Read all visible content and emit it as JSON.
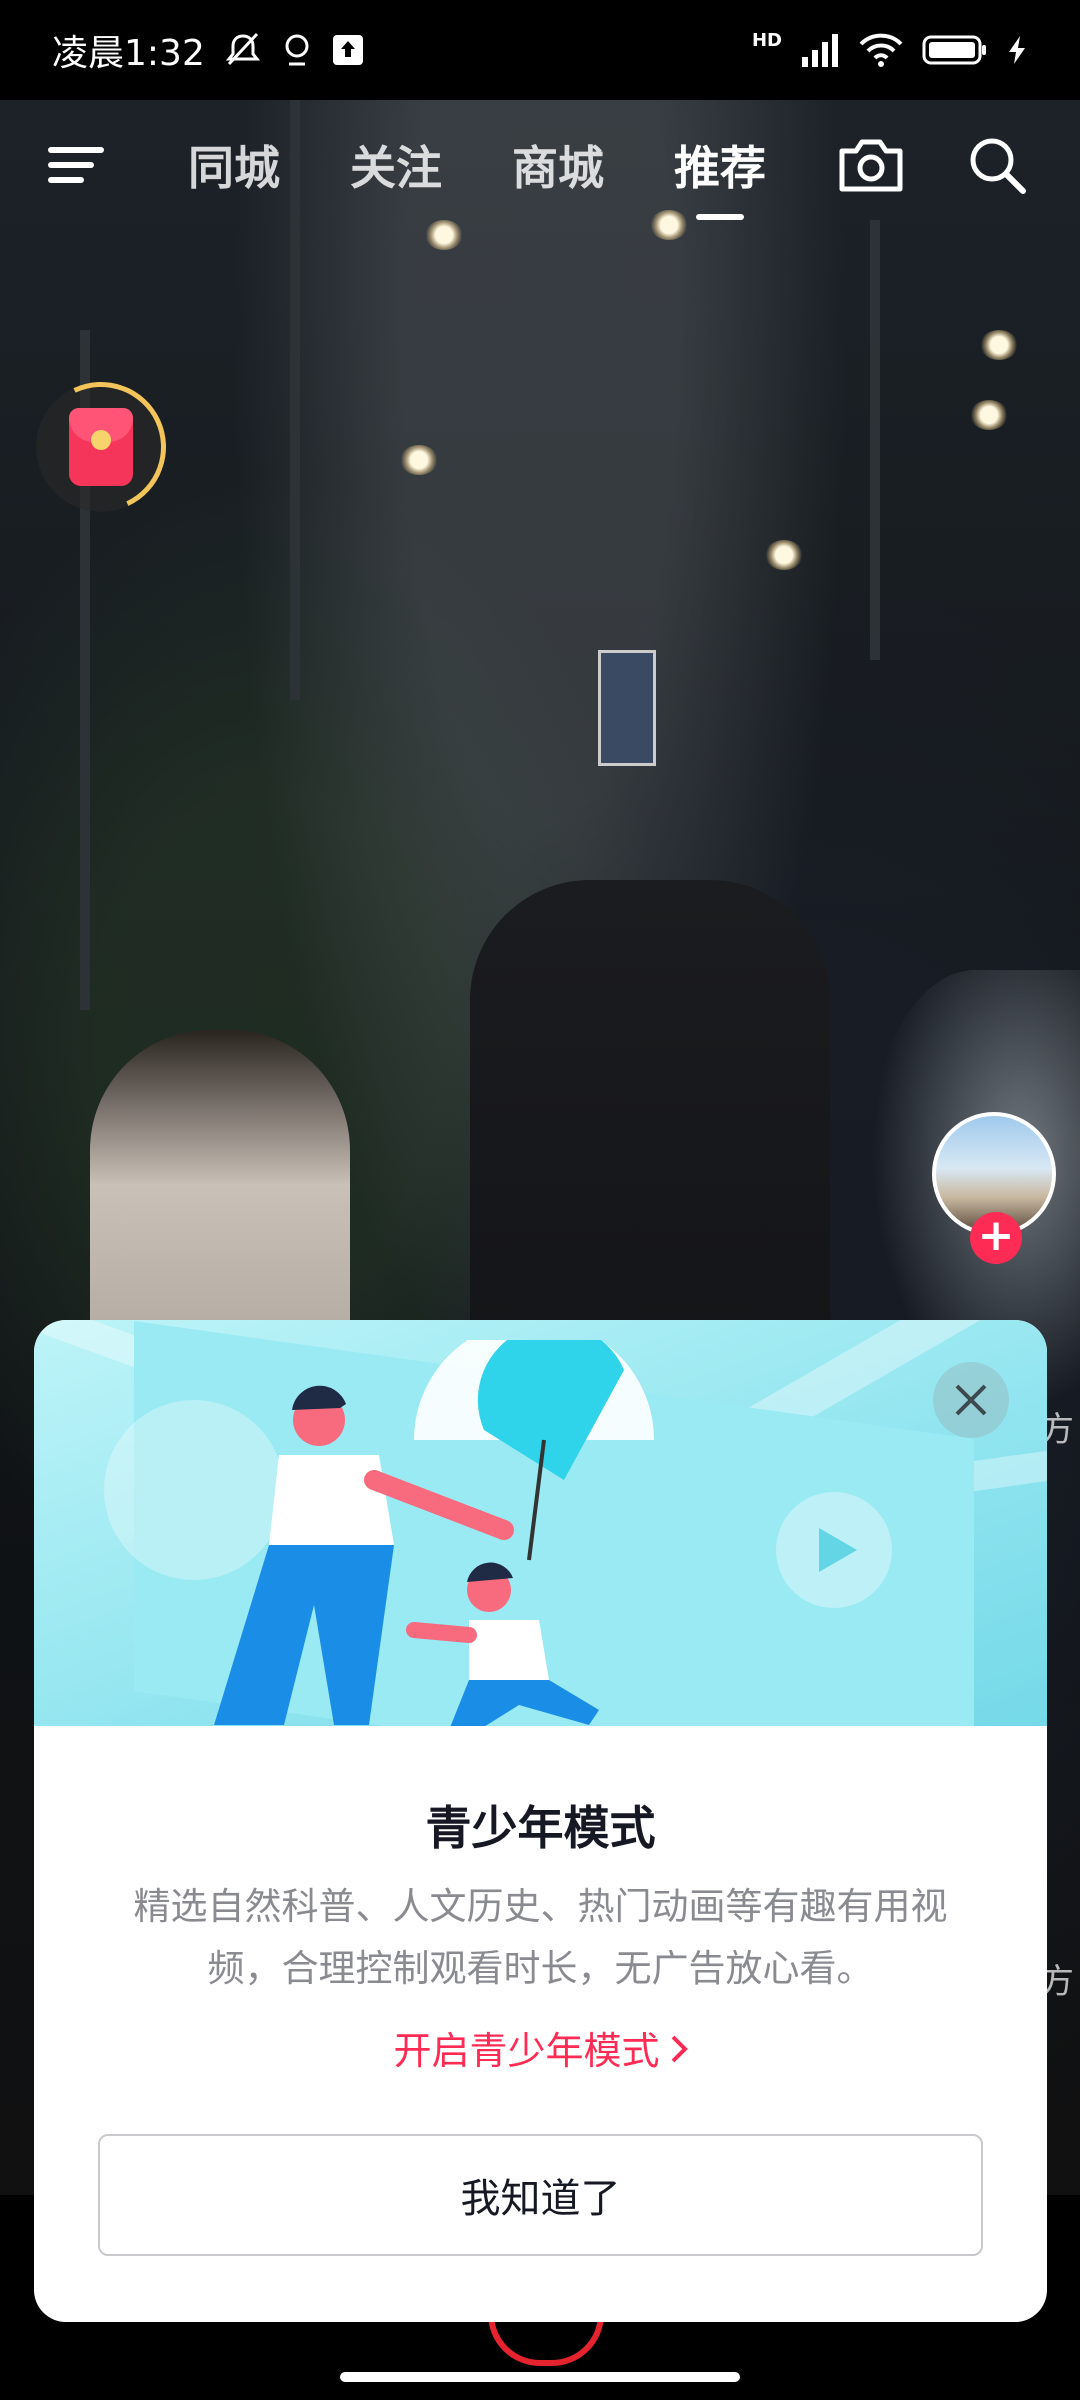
{
  "status_bar": {
    "time": "凌晨1:32",
    "network_label": "HD",
    "icons": [
      "mute-bell-icon",
      "location-icon",
      "upload-icon",
      "signal-icon",
      "wifi-icon",
      "battery-icon",
      "charging-icon"
    ]
  },
  "top_nav": {
    "tabs": [
      {
        "label": "同城"
      },
      {
        "label": "关注"
      },
      {
        "label": "商城"
      },
      {
        "label": "推荐",
        "active": true
      }
    ],
    "icons": [
      "menu-icon",
      "camera-icon",
      "search-icon"
    ]
  },
  "overlay": {
    "side_glyph_1": "方",
    "side_glyph_2": "方"
  },
  "dialog": {
    "title": "青少年模式",
    "description": "精选自然科普、人文历史、热门动画等有趣有用视频，合理控制观看时长，无广告放心看。",
    "link_label": "开启青少年模式",
    "button_label": "我知道了",
    "accent_color": "#fe2c55",
    "banner_color": "#8fe4ef"
  },
  "colors": {
    "status_bar_bg": "#000000",
    "follow_plus": "#fe2c55",
    "title_text": "#161823",
    "desc_text": "#8a8b91"
  }
}
